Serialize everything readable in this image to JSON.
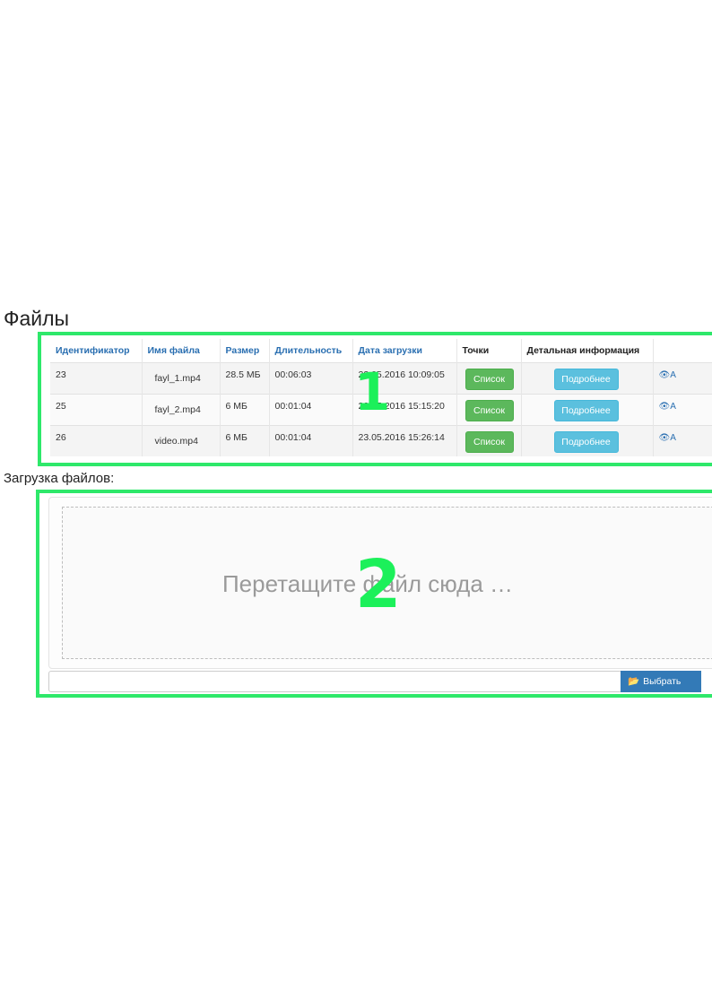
{
  "page": {
    "title": "Файлы"
  },
  "files_table": {
    "headers": [
      "Идентификатор",
      "Имя файла",
      "Размер",
      "Длительность",
      "Дата загрузки",
      "Точки",
      "Детальная информация",
      ""
    ],
    "rows": [
      {
        "id": "23",
        "name": "fayl_1.mp4",
        "size": "28.5 МБ",
        "duration": "00:06:03",
        "uploaded": "23.05.2016 10:09:05",
        "points_btn": "Список",
        "details_btn": "Подробнее",
        "view_icon": "eye-icon",
        "view_text": "А"
      },
      {
        "id": "25",
        "name": "fayl_2.mp4",
        "size": "6 МБ",
        "duration": "00:01:04",
        "uploaded": "23.05.2016 15:15:20",
        "points_btn": "Список",
        "details_btn": "Подробнее",
        "view_icon": "eye-icon",
        "view_text": "А"
      },
      {
        "id": "26",
        "name": "video.mp4",
        "size": "6 МБ",
        "duration": "00:01:04",
        "uploaded": "23.05.2016 15:26:14",
        "points_btn": "Список",
        "details_btn": "Подробнее",
        "view_icon": "eye-icon",
        "view_text": "А"
      }
    ]
  },
  "annotations": {
    "one": "1",
    "two": "2"
  },
  "upload": {
    "label": "Загрузка файлов:",
    "dropzone_text": "Перетащите файл сюда …",
    "browse_label": "Выбрать",
    "browse_icon": "folder-open-icon"
  },
  "colors": {
    "highlight": "#2ee86a",
    "success": "#5cb85c",
    "info": "#5bc0de",
    "primary": "#337ab7",
    "link": "#2a6fb1"
  }
}
